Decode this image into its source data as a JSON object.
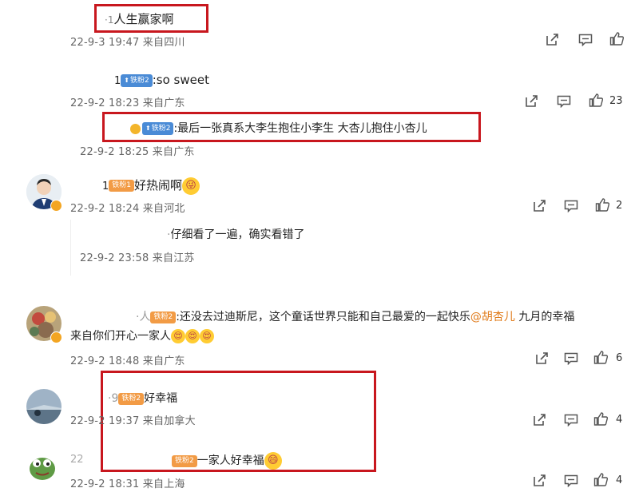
{
  "comments": [
    {
      "text": "人生赢家啊",
      "prefix": "·1",
      "meta": "22-9-3 19:47 来自四川"
    },
    {
      "prefix": "1",
      "badge": "铁粉2",
      "text": ":so sweet",
      "meta": "22-9-2 18:23 来自广东",
      "likes": "23"
    },
    {
      "badge": "铁粉2",
      "text": ":最后一张真系大李生抱住小李生 大杏儿抱住小杏儿",
      "meta": "22-9-2 18:25 来自广东"
    },
    {
      "prefix": "1",
      "badge": "铁粉1",
      "text": "好热闹啊",
      "meta": "22-9-2 18:24 来自河北",
      "likes": "2"
    },
    {
      "text": "仔细看了一遍，确实看错了",
      "prefix": "·",
      "meta": "22-9-2 23:58 来自江苏"
    },
    {
      "prefix": "·人",
      "badge": "铁粉2",
      "text_a": ":还没去过迪斯尼，这个童话世界只能和自己最爱的一起快乐",
      "mention": "@胡杏儿",
      "text_b": " 九月的幸福",
      "text_line2": "来自你们开心一家人",
      "meta": "22-9-2 18:48 来自广东",
      "likes": "6"
    },
    {
      "prefix": "·9",
      "badge": "铁粉2",
      "text": "好幸福",
      "meta": "22-9-2 19:37 来自加拿大",
      "likes": "4"
    },
    {
      "badge": "铁粉2",
      "text": "一家人好幸福",
      "meta": "22-9-2 18:31 来自上海",
      "prefix": "22",
      "likes": "4"
    }
  ]
}
